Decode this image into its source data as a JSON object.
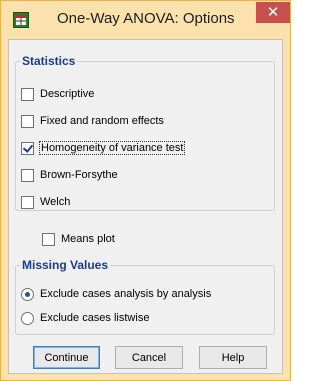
{
  "window": {
    "title": "One-Way ANOVA: Options",
    "close_glyph": "✕",
    "app_icon": "spss-grid-icon"
  },
  "statistics": {
    "label": "Statistics",
    "items": [
      {
        "label": "Descriptive",
        "checked": false
      },
      {
        "label": "Fixed and random effects",
        "checked": false
      },
      {
        "label": "Homogeneity of variance test",
        "checked": true
      },
      {
        "label": "Brown-Forsythe",
        "checked": false
      },
      {
        "label": "Welch",
        "checked": false
      }
    ]
  },
  "means_plot": {
    "label": "Means plot",
    "checked": false
  },
  "missing_values": {
    "label": "Missing Values",
    "options": [
      {
        "label": "Exclude cases analysis by analysis",
        "selected": true
      },
      {
        "label": "Exclude cases listwise",
        "selected": false
      }
    ]
  },
  "buttons": {
    "continue": "Continue",
    "cancel": "Cancel",
    "help": "Help"
  },
  "colors": {
    "titlebar": "#fbe2ad",
    "close": "#c7504e",
    "group_label": "#1c3b86"
  }
}
